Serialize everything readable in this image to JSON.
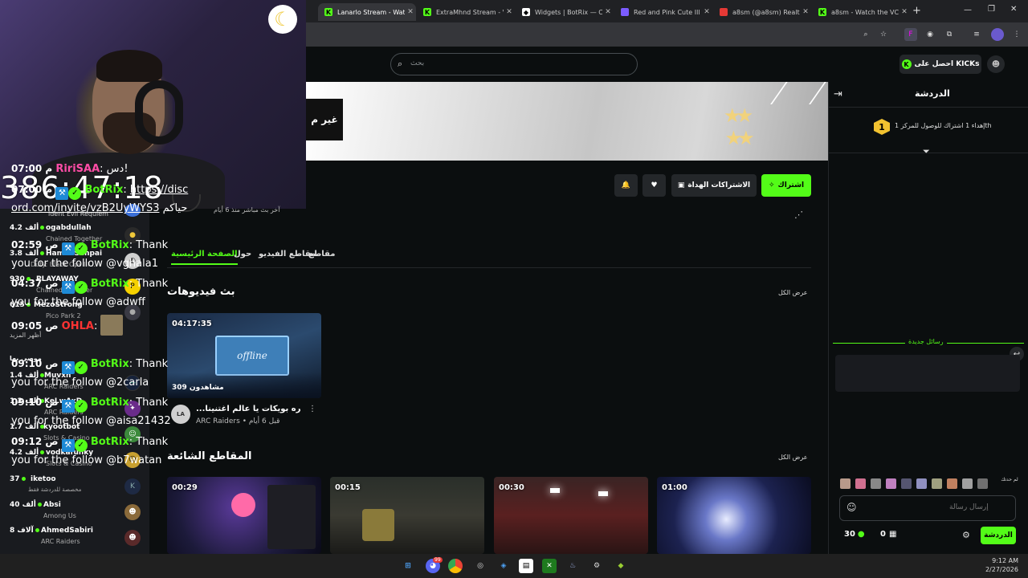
{
  "browser": {
    "tabs": [
      {
        "label": "Lanarlo Stream - Wat",
        "color": "#53fc18"
      },
      {
        "label": "ExtraMhnd Stream - V",
        "color": "#53fc18"
      },
      {
        "label": "Widgets | BotRix — C",
        "color": "#ffffff"
      },
      {
        "label": "Red and Pink Cute Ill",
        "color": "#7b5cff"
      },
      {
        "label": "a8sm (@a8sm) Realti",
        "color": "#e53935"
      },
      {
        "label": "a8sm - Watch the VC",
        "color": "#53fc18"
      }
    ]
  },
  "header": {
    "search_placeholder": "بحث",
    "get_kicks": "احصل على KICKs"
  },
  "overlay": {
    "timer": "386:47:18"
  },
  "sidebar": {
    "first_game": "ident Evil Requiem",
    "followed": [
      {
        "name": "ogabdullah",
        "viewers": "4.2 ألف",
        "game": "Chained Together"
      },
      {
        "name": "HamadSenpai",
        "viewers": "3.8 ألف",
        "game": "Duty: Black Ops III ..."
      },
      {
        "name": "PLAYAWAY",
        "viewers": "930",
        "game": "Chained Together"
      },
      {
        "name": "MezoStrong",
        "viewers": "615",
        "game": "Pico Park 2"
      }
    ],
    "show_more": "أظهر المزيد",
    "recommended_title": "موصى بها",
    "recommended": [
      {
        "name": "Muvxn",
        "viewers": "1.4 ألف",
        "game": "ARC Raiders"
      },
      {
        "name": "KeLwAxD",
        "viewers": "1.2 ألف",
        "game": "ARC Raiders"
      },
      {
        "name": "kyootbot",
        "viewers": "1.7 ألف",
        "game": "Slots & Casino"
      },
      {
        "name": "vodkafunky",
        "viewers": "4.2 ألف",
        "game": "Slots & Casino"
      },
      {
        "name": "iketoo",
        "viewers": "37",
        "game": "مخصصة للدردشة فقط"
      },
      {
        "name": "Absi",
        "viewers": "40 ألف",
        "game": "Among Us"
      },
      {
        "name": "AhmedSabiri",
        "viewers": "8 آلاف",
        "game": "ARC Raiders"
      }
    ]
  },
  "channel": {
    "offline_label": "غير م",
    "subscribe": "اشتراك",
    "gift_subs": "الاشتراكات الهداة",
    "last_live": "آخر بث مباشر منذ 6 أيام",
    "tabs": [
      "الصفحة الرئيسية",
      "حول",
      "مقاطع الفيديو",
      "مقاطع"
    ],
    "recent_streams_title": "بث فيديوهات",
    "see_all": "عرض الكل",
    "stream_card": {
      "duration": "04:17:35",
      "views": "309 مشاهدون",
      "offline_text": "offline",
      "title": "...يا عشره بويكات يا عالم اغتنينا",
      "game": "ARC Raiders",
      "ago": "قبل 6 أيام"
    },
    "clips_title": "المقاطع الشائعة",
    "clips": [
      {
        "duration": "00:29"
      },
      {
        "duration": "00:15"
      },
      {
        "duration": "00:30"
      },
      {
        "duration": "01:00"
      }
    ]
  },
  "chat": {
    "title": "الدردشة",
    "goal_text": "إهداء 1 اشتراك للوصول للمركز 1th",
    "goal_number": "1",
    "new_messages": "رسائل جديدة",
    "messages": [
      {
        "time": "07:00 م",
        "user": "RiriSAA",
        "text": "دس!"
      },
      {
        "time": "07:00 م",
        "user": "BotRix",
        "link": "https://discord.com/invite/vzB2UyWYS3",
        "text": "حياكم"
      },
      {
        "time": "02:59 ص",
        "user": "BotRix",
        "text": "Thank you for the follow @vghala1"
      },
      {
        "time": "04:37 ص",
        "user": "BotRix",
        "text": "Thank you for the follow @adwff"
      },
      {
        "time": "09:05 ص",
        "user": "OHLA",
        "text": ""
      },
      {
        "time": "09:10 ص",
        "user": "BotRix",
        "text": "Thank you for the follow @2carla"
      },
      {
        "time": "09:10 ص",
        "user": "BotRix",
        "text": "Thank you for the follow @aisa21432"
      },
      {
        "time": "09:12 ص",
        "user": "BotRix",
        "text": "Thank you for the follow @b7watan"
      }
    ],
    "emote_label": "لم حدتك",
    "input_placeholder": "إرسال رسالة",
    "points": "30",
    "store_count": "0",
    "send_label": "الدردشة"
  },
  "taskbar": {
    "time": "9:12 AM",
    "date": "2/27/2026",
    "discord_badge": "99"
  }
}
